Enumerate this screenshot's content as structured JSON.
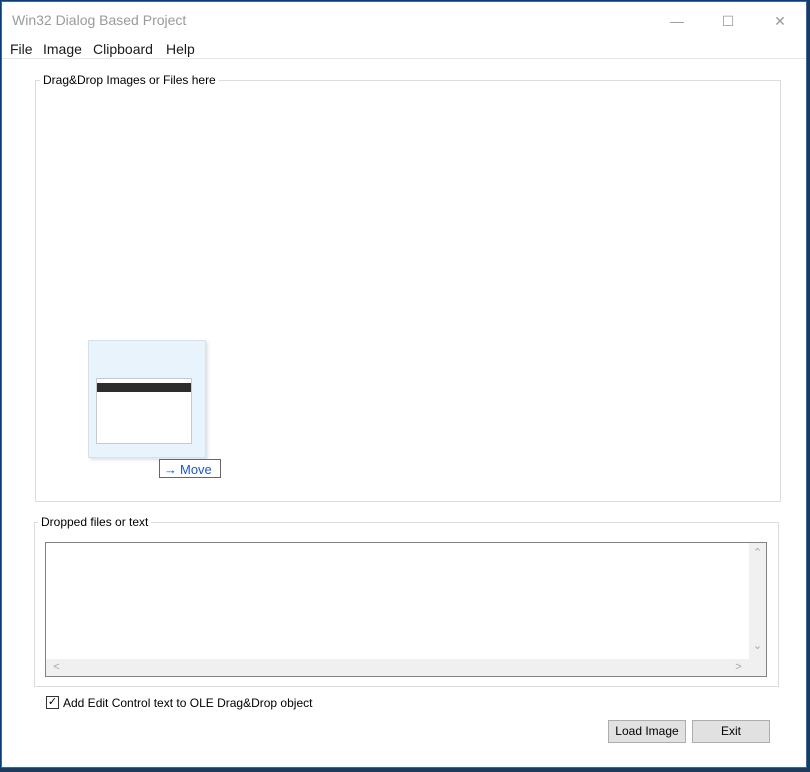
{
  "window": {
    "title": "Win32 Dialog Based Project",
    "minimize_glyph": "—",
    "maximize_glyph": "☐",
    "close_glyph": "✕"
  },
  "menu": {
    "items": [
      {
        "label": "File"
      },
      {
        "label": "Image"
      },
      {
        "label": "Clipboard"
      },
      {
        "label": "Help"
      }
    ]
  },
  "drop_area": {
    "label": "Drag&Drop Images or Files here",
    "drag_feedback": {
      "arrow_glyph": "→",
      "effect_label": "Move"
    }
  },
  "dropped": {
    "label": "Dropped files or text",
    "text_value": "",
    "scroll_up_glyph": "⌃",
    "scroll_down_glyph": "⌄",
    "scroll_left_glyph": "<",
    "scroll_right_glyph": ">"
  },
  "options": {
    "add_edit_text_checked": true,
    "check_glyph": "✓",
    "add_edit_text_label": "Add Edit Control text to OLE Drag&Drop object"
  },
  "buttons": {
    "load_image": "Load Image",
    "exit": "Exit"
  },
  "colors": {
    "window_border": "#2b6cb0",
    "desktop": "#1e3a5c",
    "move_text": "#1f55c9"
  }
}
